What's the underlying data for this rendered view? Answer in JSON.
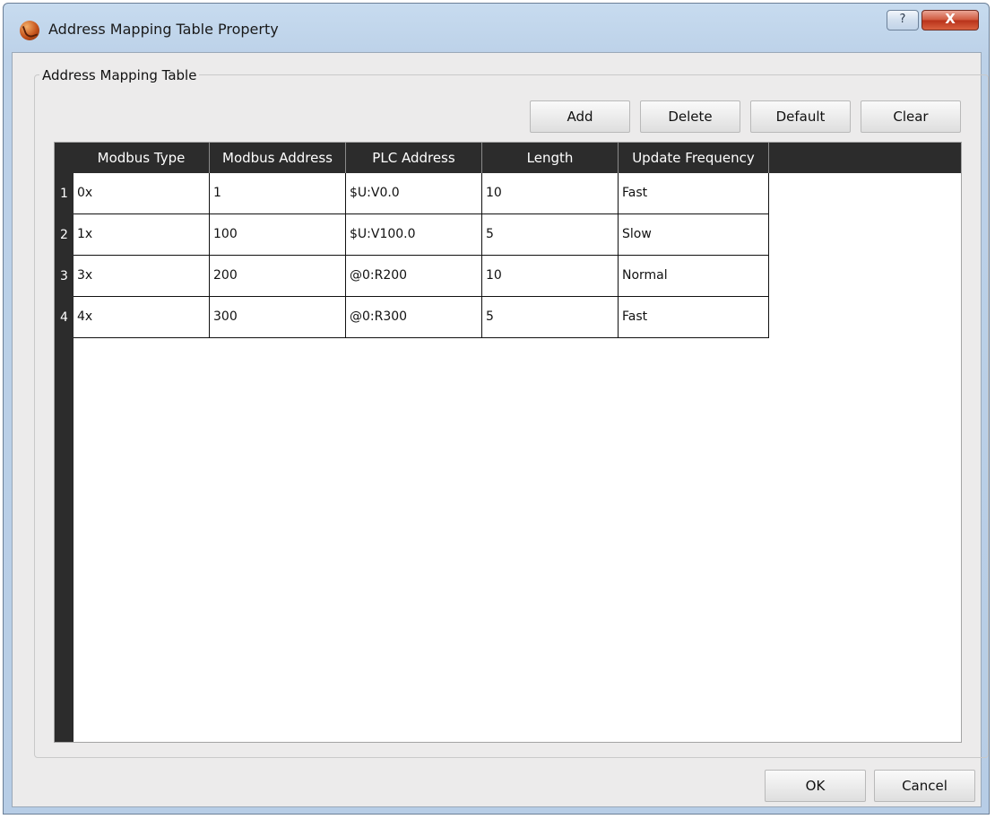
{
  "window": {
    "title": "Address Mapping Table Property",
    "help_label": "?",
    "close_label": "X"
  },
  "group": {
    "title": "Address Mapping Table"
  },
  "toolbar": {
    "add_label": "Add",
    "delete_label": "Delete",
    "default_label": "Default",
    "clear_label": "Clear"
  },
  "table": {
    "columns": [
      "Modbus Type",
      "Modbus Address",
      "PLC Address",
      "Length",
      "Update Frequency"
    ],
    "rows": [
      {
        "num": "1",
        "cells": [
          "0x",
          "1",
          "$U:V0.0",
          "10",
          "Fast"
        ]
      },
      {
        "num": "2",
        "cells": [
          "1x",
          "100",
          "$U:V100.0",
          "5",
          "Slow"
        ]
      },
      {
        "num": "3",
        "cells": [
          "3x",
          "200",
          "@0:R200",
          "10",
          "Normal"
        ]
      },
      {
        "num": "4",
        "cells": [
          "4x",
          "300",
          "@0:R300",
          "5",
          "Fast"
        ]
      }
    ]
  },
  "footer": {
    "ok_label": "OK",
    "cancel_label": "Cancel"
  },
  "colors": {
    "title_bar": "#bcd1e8",
    "close_button": "#c9452a",
    "header_bg": "#2c2c2c",
    "client_bg": "#ecebeb"
  },
  "icons": {
    "app": "app-logo-icon",
    "help": "help-icon",
    "close": "close-icon"
  }
}
